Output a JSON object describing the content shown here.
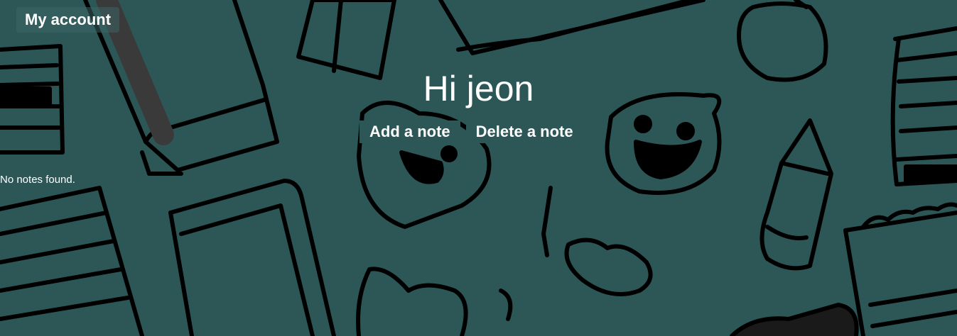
{
  "header": {
    "account_label": "My account"
  },
  "main": {
    "greeting": "Hi jeon",
    "actions": {
      "add_label": "Add a note",
      "delete_label": "Delete a note"
    },
    "empty_message": "No notes found."
  },
  "theme": {
    "background": "#2d5757",
    "text": "#ffffff",
    "doodle_stroke": "#000000"
  }
}
